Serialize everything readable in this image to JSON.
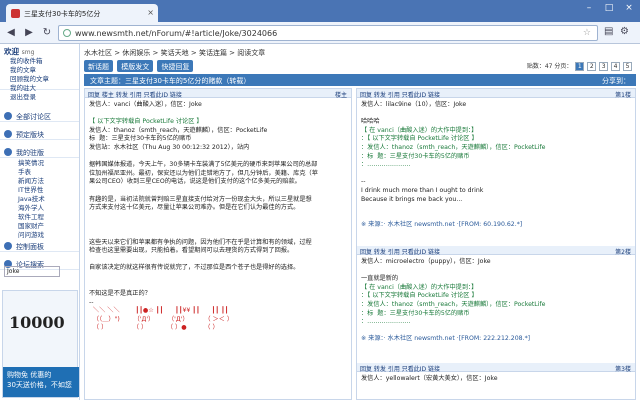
{
  "browser": {
    "tab_title": "三星支付30卡车的5亿分",
    "url": "www.newsmth.net/nForum/#!article/Joke/3024066"
  },
  "sidebar": {
    "welcome": "欢迎",
    "welcome_user": "smg",
    "links": [
      "我的收件箱",
      "我的文章",
      "回顾我的文章",
      "我的驻大",
      "退出登录"
    ],
    "sections": [
      {
        "label": "全部讨论区"
      },
      {
        "label": "预定版块"
      },
      {
        "label": "我的驻版"
      }
    ],
    "boards": [
      "搞笑情况",
      "手表",
      "新闻方法",
      "IT世界性",
      "Java技术",
      "海外学人",
      "软件工程",
      "国家财产",
      "问问游戏"
    ],
    "control": "控制面板",
    "forum_search": "论坛搜索",
    "search_value": "Joke",
    "ad_big": "10000",
    "ad_line1": "购物免 优惠的",
    "ad_line2": "30天送价格，不如您"
  },
  "main": {
    "breadcrumb": "水木社区 > 休闲娱乐 > 笑话天地 > 笑话连篇 > 阅读文章",
    "buttons": [
      "新话题",
      "模版发文",
      "快捷回复"
    ],
    "pager": {
      "label": "贴数：47 分页：",
      "pages": [
        "1",
        "2",
        "3",
        "4",
        "5"
      ],
      "current": "1"
    },
    "title": "文章主题：三星支付30卡车的5亿分的赌款（转载）",
    "share": "分享到："
  },
  "posts": [
    {
      "actions": "回复 楼主 转发 引用 只看此ID 链接",
      "floor": "楼主",
      "lines": [
        "发信人：vanci（曲酸入迷），信区：Joke",
        "",
        "【 以下文字转载自 PocketLife 讨论区 】",
        "发信人：thanoz（smth_reach，天遊麒麟），信区：PocketLife",
        "标  题：三星支付30卡车的5亿的赌币",
        "发信站：水木社区（Thu Aug 30 00:12:32 2012），站内",
        "",
        "据韩国媒体报道，今天上午，30多辆卡车装满了5亿美元的硬币来到苹果公司的总部",
        "位加州福尼亚州。最初，保安还以为他们走错地方了，但几分钟后，美籍、库克（苹",
        "果公司CEO）收到三星CEO的电话，说这是他们支付的这个亿多美元的赔款。",
        "",
        "有趣的是，当初法院就曾判赔三星直接支付给对方一份现金大头，所以三星就是想",
        "方式来支付这十亿美元，尽量让苹果公司难办。但是在它们认为最佳的方式。",
        "",
        "",
        "",
        "这些天以来它们和苹果都有争执的问题，因为他们不在乎是计算和有的领域，过程",
        "检查也这里需要出现，只能拍着。看望期间可以去理货的方式得到了回报。",
        "",
        "自家该决定的就这样很有传说就完了，不过那位是西个苍子也是得好的选择。",
        "",
        "",
        "不知这是不是真正的？",
        "--"
      ],
      "emotes": [
        "  ＼＼ ＼＼        ┃┃●☆ ┃┃      ┃┃¥¥ ┃┃      ┃┃ ┃┃",
        "  （（＿）\")       （'Д'）       （'Д'）        （ ＞＜ ）",
        "  （ ）             （ ）          （ ）●         （ ）"
      ]
    },
    {
      "actions": "回复 转发 引用 只看此ID 链接",
      "floor": "第1楼",
      "lines": [
        "发信人：lilac9ine（10），信区：Joke",
        "",
        "哈哈哈",
        "【 在 vanci（曲酸入迷）的大作中提到：】",
        "：【 以下文字转载自 PocketLife 讨论区 】",
        "：发信人：thanoz（smth_reach，天遊麒麟），信区：PocketLife",
        "：标  题：三星支付30卡车的5亿的赌币",
        "：…………………",
        "",
        "--",
        "I drink much more than I ought to drink",
        "Because it brings me back you...",
        "",
        "",
        "※ 来源：· 水木社区 newsmth.net ·[FROM: 60.190.62.*]"
      ]
    },
    {
      "actions": "回复 转发 引用 只看此ID 链接",
      "floor": "第2楼",
      "lines": [
        "发信人：microelectro（puppy），信区：Joke",
        "",
        "一直就是新的",
        "【 在 vanci（曲酸入迷）的大作中提到：】",
        "：【 以下文字转载自 PocketLife 讨论区 】",
        "：发信人：thanoz（smth_reach，天遊麒麟），信区：PocketLife",
        "：标  题：三星支付30卡车的5亿的赌币",
        "：…………………",
        "",
        "※ 来源：· 水木社区 newsmth.net ·[FROM: 222.212.208.*]"
      ]
    },
    {
      "actions": "回复 转发 引用 只看此ID 链接",
      "floor": "第3楼",
      "lines": [
        "发信人：yellowalert（宏黄大美女），信区：Joke"
      ]
    }
  ]
}
